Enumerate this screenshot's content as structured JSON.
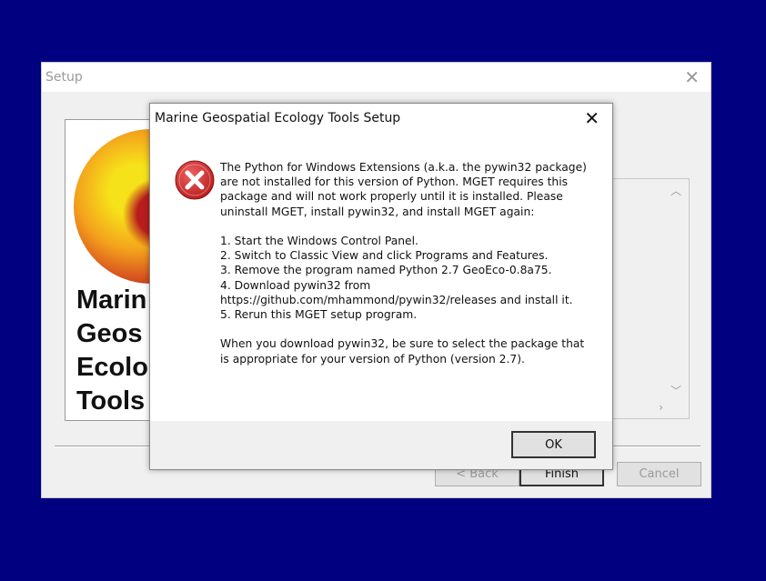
{
  "setup_window": {
    "title": "Setup",
    "banner_text": "Marin\nGeos\nEcolo\nTools",
    "buttons": {
      "back": "< Back",
      "finish": "Finish",
      "cancel": "Cancel"
    }
  },
  "dialog": {
    "title": "Marine Geospatial Ecology Tools Setup",
    "message": "The Python for Windows Extensions (a.k.a. the pywin32 package) are not installed for this version of Python. MGET requires this package and will not work properly until it is installed. Please uninstall MGET, install pywin32, and install MGET again:\n\n1. Start the Windows Control Panel.\n2. Switch to Classic View and click Programs and Features.\n3. Remove the program named Python 2.7 GeoEco-0.8a75.\n4. Download pywin32 from https://github.com/mhammond/pywin32/releases and install it.\n5. Rerun this MGET setup program.\n\nWhen you download pywin32, be sure to select the package that is appropriate for your version of Python (version 2.7).",
    "ok_label": "OK",
    "icon": "error-icon"
  },
  "colors": {
    "desktop": "#000080",
    "error_red": "#d32f2f"
  }
}
